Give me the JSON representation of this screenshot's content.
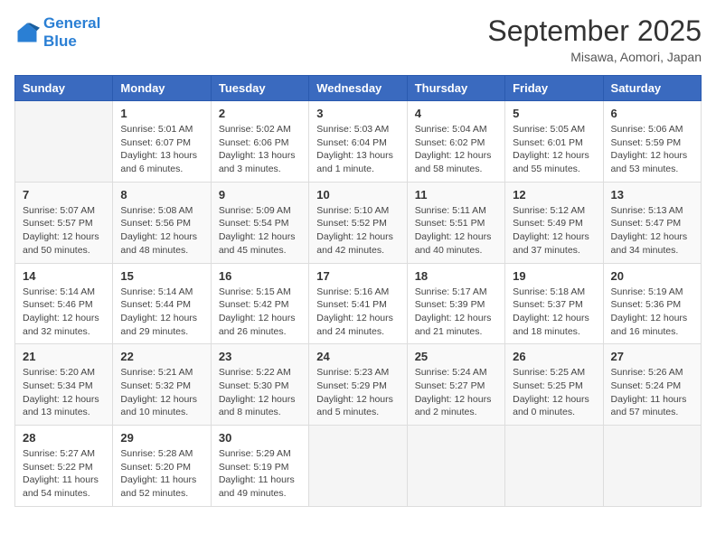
{
  "logo": {
    "line1": "General",
    "line2": "Blue"
  },
  "title": "September 2025",
  "subtitle": "Misawa, Aomori, Japan",
  "days_of_week": [
    "Sunday",
    "Monday",
    "Tuesday",
    "Wednesday",
    "Thursday",
    "Friday",
    "Saturday"
  ],
  "weeks": [
    [
      {
        "day": "",
        "sunrise": "",
        "sunset": "",
        "daylight": ""
      },
      {
        "day": "1",
        "sunrise": "Sunrise: 5:01 AM",
        "sunset": "Sunset: 6:07 PM",
        "daylight": "Daylight: 13 hours and 6 minutes."
      },
      {
        "day": "2",
        "sunrise": "Sunrise: 5:02 AM",
        "sunset": "Sunset: 6:06 PM",
        "daylight": "Daylight: 13 hours and 3 minutes."
      },
      {
        "day": "3",
        "sunrise": "Sunrise: 5:03 AM",
        "sunset": "Sunset: 6:04 PM",
        "daylight": "Daylight: 13 hours and 1 minute."
      },
      {
        "day": "4",
        "sunrise": "Sunrise: 5:04 AM",
        "sunset": "Sunset: 6:02 PM",
        "daylight": "Daylight: 12 hours and 58 minutes."
      },
      {
        "day": "5",
        "sunrise": "Sunrise: 5:05 AM",
        "sunset": "Sunset: 6:01 PM",
        "daylight": "Daylight: 12 hours and 55 minutes."
      },
      {
        "day": "6",
        "sunrise": "Sunrise: 5:06 AM",
        "sunset": "Sunset: 5:59 PM",
        "daylight": "Daylight: 12 hours and 53 minutes."
      }
    ],
    [
      {
        "day": "7",
        "sunrise": "Sunrise: 5:07 AM",
        "sunset": "Sunset: 5:57 PM",
        "daylight": "Daylight: 12 hours and 50 minutes."
      },
      {
        "day": "8",
        "sunrise": "Sunrise: 5:08 AM",
        "sunset": "Sunset: 5:56 PM",
        "daylight": "Daylight: 12 hours and 48 minutes."
      },
      {
        "day": "9",
        "sunrise": "Sunrise: 5:09 AM",
        "sunset": "Sunset: 5:54 PM",
        "daylight": "Daylight: 12 hours and 45 minutes."
      },
      {
        "day": "10",
        "sunrise": "Sunrise: 5:10 AM",
        "sunset": "Sunset: 5:52 PM",
        "daylight": "Daylight: 12 hours and 42 minutes."
      },
      {
        "day": "11",
        "sunrise": "Sunrise: 5:11 AM",
        "sunset": "Sunset: 5:51 PM",
        "daylight": "Daylight: 12 hours and 40 minutes."
      },
      {
        "day": "12",
        "sunrise": "Sunrise: 5:12 AM",
        "sunset": "Sunset: 5:49 PM",
        "daylight": "Daylight: 12 hours and 37 minutes."
      },
      {
        "day": "13",
        "sunrise": "Sunrise: 5:13 AM",
        "sunset": "Sunset: 5:47 PM",
        "daylight": "Daylight: 12 hours and 34 minutes."
      }
    ],
    [
      {
        "day": "14",
        "sunrise": "Sunrise: 5:14 AM",
        "sunset": "Sunset: 5:46 PM",
        "daylight": "Daylight: 12 hours and 32 minutes."
      },
      {
        "day": "15",
        "sunrise": "Sunrise: 5:14 AM",
        "sunset": "Sunset: 5:44 PM",
        "daylight": "Daylight: 12 hours and 29 minutes."
      },
      {
        "day": "16",
        "sunrise": "Sunrise: 5:15 AM",
        "sunset": "Sunset: 5:42 PM",
        "daylight": "Daylight: 12 hours and 26 minutes."
      },
      {
        "day": "17",
        "sunrise": "Sunrise: 5:16 AM",
        "sunset": "Sunset: 5:41 PM",
        "daylight": "Daylight: 12 hours and 24 minutes."
      },
      {
        "day": "18",
        "sunrise": "Sunrise: 5:17 AM",
        "sunset": "Sunset: 5:39 PM",
        "daylight": "Daylight: 12 hours and 21 minutes."
      },
      {
        "day": "19",
        "sunrise": "Sunrise: 5:18 AM",
        "sunset": "Sunset: 5:37 PM",
        "daylight": "Daylight: 12 hours and 18 minutes."
      },
      {
        "day": "20",
        "sunrise": "Sunrise: 5:19 AM",
        "sunset": "Sunset: 5:36 PM",
        "daylight": "Daylight: 12 hours and 16 minutes."
      }
    ],
    [
      {
        "day": "21",
        "sunrise": "Sunrise: 5:20 AM",
        "sunset": "Sunset: 5:34 PM",
        "daylight": "Daylight: 12 hours and 13 minutes."
      },
      {
        "day": "22",
        "sunrise": "Sunrise: 5:21 AM",
        "sunset": "Sunset: 5:32 PM",
        "daylight": "Daylight: 12 hours and 10 minutes."
      },
      {
        "day": "23",
        "sunrise": "Sunrise: 5:22 AM",
        "sunset": "Sunset: 5:30 PM",
        "daylight": "Daylight: 12 hours and 8 minutes."
      },
      {
        "day": "24",
        "sunrise": "Sunrise: 5:23 AM",
        "sunset": "Sunset: 5:29 PM",
        "daylight": "Daylight: 12 hours and 5 minutes."
      },
      {
        "day": "25",
        "sunrise": "Sunrise: 5:24 AM",
        "sunset": "Sunset: 5:27 PM",
        "daylight": "Daylight: 12 hours and 2 minutes."
      },
      {
        "day": "26",
        "sunrise": "Sunrise: 5:25 AM",
        "sunset": "Sunset: 5:25 PM",
        "daylight": "Daylight: 12 hours and 0 minutes."
      },
      {
        "day": "27",
        "sunrise": "Sunrise: 5:26 AM",
        "sunset": "Sunset: 5:24 PM",
        "daylight": "Daylight: 11 hours and 57 minutes."
      }
    ],
    [
      {
        "day": "28",
        "sunrise": "Sunrise: 5:27 AM",
        "sunset": "Sunset: 5:22 PM",
        "daylight": "Daylight: 11 hours and 54 minutes."
      },
      {
        "day": "29",
        "sunrise": "Sunrise: 5:28 AM",
        "sunset": "Sunset: 5:20 PM",
        "daylight": "Daylight: 11 hours and 52 minutes."
      },
      {
        "day": "30",
        "sunrise": "Sunrise: 5:29 AM",
        "sunset": "Sunset: 5:19 PM",
        "daylight": "Daylight: 11 hours and 49 minutes."
      },
      {
        "day": "",
        "sunrise": "",
        "sunset": "",
        "daylight": ""
      },
      {
        "day": "",
        "sunrise": "",
        "sunset": "",
        "daylight": ""
      },
      {
        "day": "",
        "sunrise": "",
        "sunset": "",
        "daylight": ""
      },
      {
        "day": "",
        "sunrise": "",
        "sunset": "",
        "daylight": ""
      }
    ]
  ]
}
